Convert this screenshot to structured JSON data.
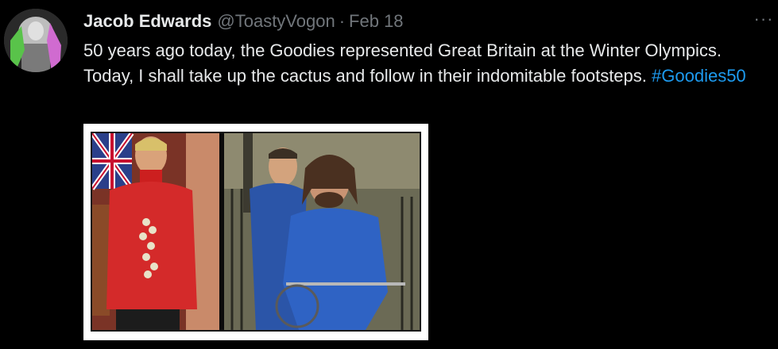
{
  "tweet": {
    "author": {
      "display_name": "Jacob Edwards",
      "handle": "@ToastyVogon",
      "avatar_icon": "profile-photo"
    },
    "separator": "·",
    "date": "Feb 18",
    "more_label": "···",
    "text": "50 years ago today, the Goodies represented Great Britain at the Winter Olympics. Today, I shall take up the cactus and follow in their indomitable footsteps.",
    "hashtag": "#Goodies50",
    "media": {
      "type": "photo",
      "description_icon": "photo-collage"
    }
  },
  "colors": {
    "background": "#000000",
    "text_primary": "#e7e9ea",
    "text_secondary": "#71767b",
    "link": "#1d9bf0"
  }
}
